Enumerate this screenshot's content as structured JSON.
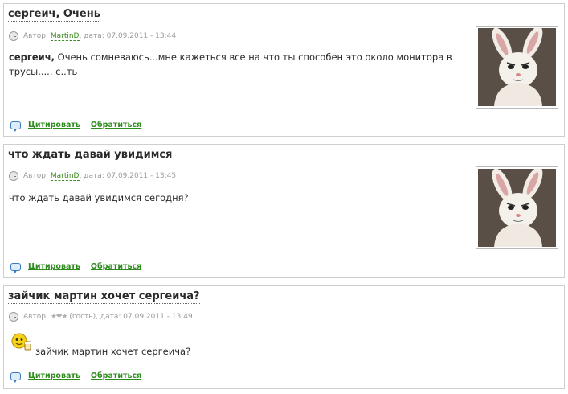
{
  "posts": [
    {
      "title": "сергеич, Очень",
      "author_label": "Автор:",
      "author": "MartinD",
      "date_label": ", дата:",
      "date": "07.09.2011 - 13:44",
      "text_bold": "сергеич,",
      "text": " Очень сомневаюсь...мне кажеться все на что ты способен это около монитора в трусы..... с..ть",
      "quote_label": "Цитировать",
      "reply_label": "Обратиться",
      "avatar_icon": "rabbit-costume-avatar"
    },
    {
      "title": "что ждать давай увидимся",
      "author_label": "Автор:",
      "author": "MartinD",
      "date_label": ", дата:",
      "date": "07.09.2011 - 13:45",
      "text": "что ждать давай увидимся сегодня?",
      "quote_label": "Цитировать",
      "reply_label": "Обратиться",
      "avatar_icon": "rabbit-costume-avatar"
    },
    {
      "title": "зайчик мартин хочет сергеича?",
      "author_label": "Автор:",
      "author": "★❤★",
      "author_suffix": "(гость)",
      "date_label": ", дата:",
      "date": "07.09.2011 - 13:49",
      "text": "зайчик мартин хочет сергеича?",
      "quote_label": "Цитировать",
      "reply_label": "Обратиться",
      "smiley_icon": "beer-smiley-icon"
    }
  ],
  "colors": {
    "link_green": "#2e8b1e",
    "meta_gray": "#9a9a9a",
    "border": "#cfcfcf"
  }
}
